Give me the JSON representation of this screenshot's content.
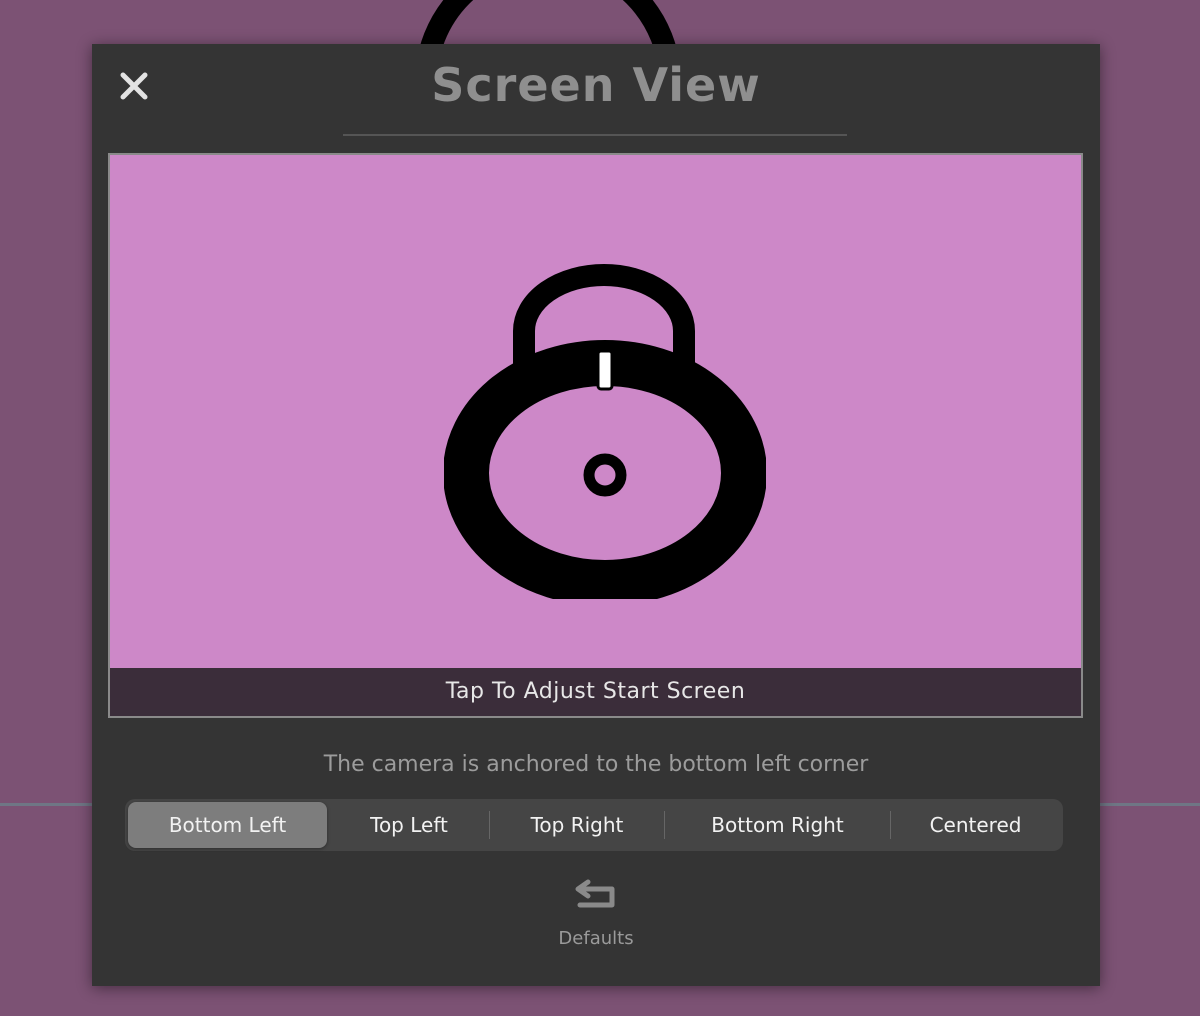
{
  "dialog": {
    "title": "Screen View",
    "close_icon": "close-icon"
  },
  "preview": {
    "caption": "Tap To Adjust Start Screen",
    "icon": "padlock-icon",
    "background_color": "#cd88c8"
  },
  "anchor": {
    "hint": "The camera is anchored to the bottom left corner",
    "options": [
      {
        "label": "Bottom Left",
        "selected": true
      },
      {
        "label": "Top Left",
        "selected": false
      },
      {
        "label": "Top Right",
        "selected": false
      },
      {
        "label": "Bottom Right",
        "selected": false
      },
      {
        "label": "Centered",
        "selected": false
      }
    ]
  },
  "defaults": {
    "label": "Defaults",
    "icon": "undo-arrow-icon"
  }
}
